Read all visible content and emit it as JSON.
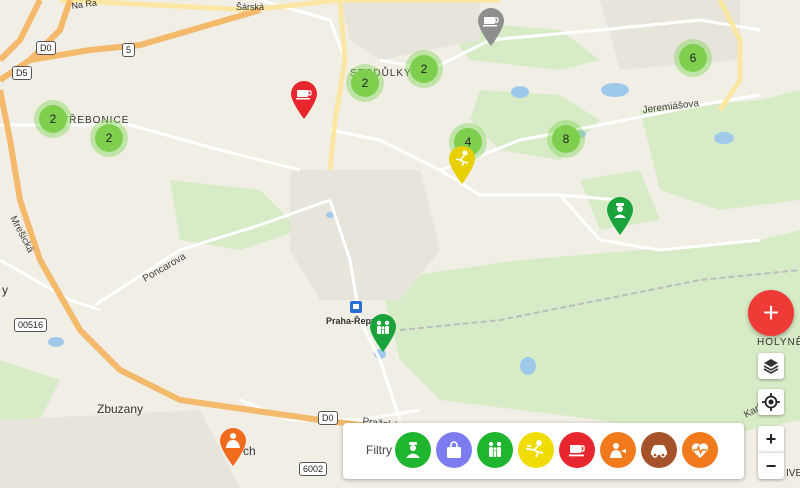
{
  "places": {
    "trebonice": "TŘEBONICE",
    "stodulky": "STODŮLKY",
    "zbuzany": "Zbuzany",
    "praha_repy": "Praha-Řepy",
    "holyne": "HOLYNĚ",
    "sarska": "Šárská",
    "na_radosti": "Na Ra",
    "y_label": "y",
    "ch_label": "ch",
    "live_label": "IVE"
  },
  "roads": {
    "jeremiasova": "Jeremiášova",
    "poncarova": "Poncarova",
    "mresicka": "Mrešická",
    "prazska": "Pražská",
    "karlstejn": "Karlštejn"
  },
  "shields": {
    "d0_top": "D0",
    "r5": "5",
    "d5": "D5",
    "r00516": "00516",
    "d0_bottom": "D0",
    "r6002": "6002"
  },
  "clusters": [
    {
      "id": "trebonice-a",
      "count": "2"
    },
    {
      "id": "trebonice-b",
      "count": "2"
    },
    {
      "id": "stodulky-a",
      "count": "2"
    },
    {
      "id": "stodulky-b",
      "count": "2"
    },
    {
      "id": "center",
      "count": "4"
    },
    {
      "id": "east",
      "count": "8"
    },
    {
      "id": "northeast",
      "count": "6"
    }
  ],
  "pins": [
    {
      "name": "cafe-pin-gray",
      "color": "#8e8e8e",
      "icon": "coffee-icon"
    },
    {
      "name": "cafe-pin-red",
      "color": "#e8262d",
      "icon": "coffee-icon"
    },
    {
      "name": "sport-pin-yellow",
      "color": "#e8d000",
      "icon": "running-icon"
    },
    {
      "name": "doctor-pin-green",
      "color": "#19a33a",
      "icon": "nurse-icon"
    },
    {
      "name": "family-pin-green",
      "color": "#19a33a",
      "icon": "family-icon"
    },
    {
      "name": "senior-pin-orange",
      "color": "#f06b1c",
      "icon": "caregiver-icon"
    }
  ],
  "controls": {
    "add": "+",
    "zoom_in": "+",
    "zoom_out": "−"
  },
  "filters": {
    "label": "Filtry",
    "items": [
      {
        "name": "filter-doctor",
        "color": "#1fb52e",
        "icon": "nurse-icon"
      },
      {
        "name": "filter-shopping",
        "color": "#7c7cf0",
        "icon": "shopping-bag-icon"
      },
      {
        "name": "filter-family",
        "color": "#1fb52e",
        "icon": "family-icon"
      },
      {
        "name": "filter-sport",
        "color": "#f0dc00",
        "icon": "running-icon"
      },
      {
        "name": "filter-cafe",
        "color": "#e8262d",
        "icon": "coffee-icon"
      },
      {
        "name": "filter-care",
        "color": "#f07a1c",
        "icon": "caregiver-icon"
      },
      {
        "name": "filter-car",
        "color": "#a5522a",
        "icon": "car-icon"
      },
      {
        "name": "filter-health",
        "color": "#f07a1c",
        "icon": "heartbeat-icon"
      }
    ]
  }
}
